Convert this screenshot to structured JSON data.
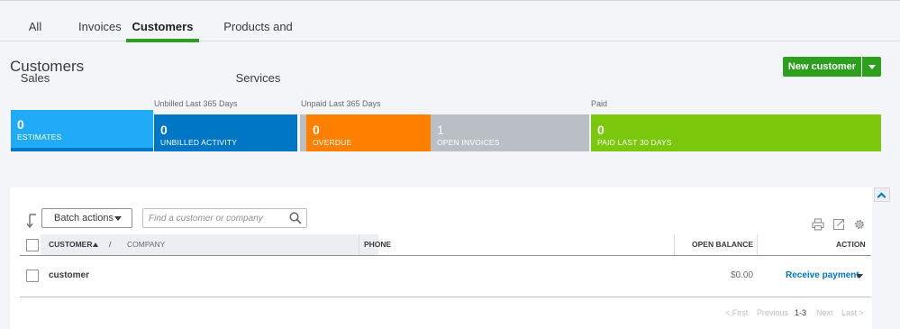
{
  "tabs": [
    {
      "label": "All Sales"
    },
    {
      "label": "Invoices"
    },
    {
      "label": "Customers"
    },
    {
      "label": "Products and Services"
    }
  ],
  "page": {
    "title": "Customers"
  },
  "header": {
    "new_customer_label": "New customer"
  },
  "summary": {
    "labels": {
      "unbilled": "Unbilled Last 365 Days",
      "unpaid": "Unpaid Last 365 Days",
      "paid": "Paid"
    },
    "tiles": {
      "estimates": {
        "value": "0",
        "label": "ESTIMATES"
      },
      "unbilled_activity": {
        "value": "0",
        "label": "UNBILLED ACTIVITY"
      },
      "overdue": {
        "value": "0",
        "label": "OVERDUE"
      },
      "open_invoices": {
        "value": "1",
        "label": "OPEN INVOICES"
      },
      "paid_last_30": {
        "value": "0",
        "label": "PAID LAST 30 DAYS"
      }
    }
  },
  "toolbar": {
    "batch_actions_label": "Batch actions",
    "search_placeholder": "Find a customer or company"
  },
  "table": {
    "columns": {
      "customer": "CUSTOMER",
      "slash": "/",
      "company": "COMPANY",
      "phone": "PHONE",
      "open_balance": "OPEN BALANCE",
      "action": "ACTION"
    },
    "rows": [
      {
        "customer": "customer",
        "phone": "",
        "open_balance": "$0.00",
        "action": "Receive payment"
      }
    ]
  },
  "pagination": {
    "first": "< First",
    "previous": "Previous",
    "range": "1-3",
    "next": "Next",
    "last": "Last >"
  },
  "colors": {
    "brand_green": "#2ca01c",
    "estimates": "#21abf6",
    "unbilled": "#0077c5",
    "overdue": "#ff8000",
    "open_invoices": "#babec5",
    "paid": "#7ac70c",
    "link": "#0077c5"
  }
}
